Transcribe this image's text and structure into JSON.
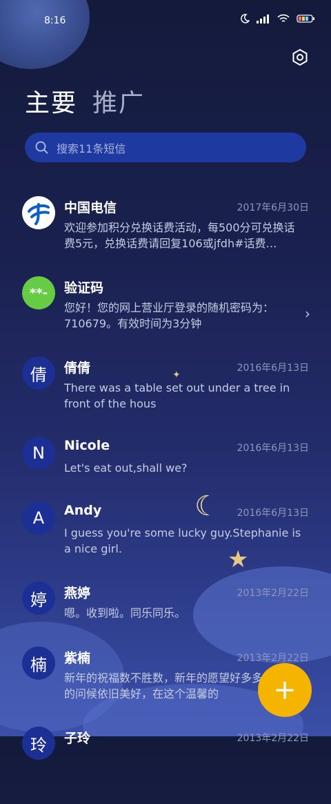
{
  "status": {
    "time": "8:16"
  },
  "tabs": [
    {
      "label": "主要"
    },
    {
      "label": "推广"
    }
  ],
  "search": {
    "placeholder": "搜索11条短信"
  },
  "messages": [
    {
      "name": "中国电信",
      "date": "2017年6月30日",
      "snippet": "欢迎参加积分兑换话费活动，每500分可兑换话费5元，兑换话费请回复106或jfdh#话费…",
      "avatar": ""
    },
    {
      "name": "验证码",
      "date": "",
      "snippet": "您好！您的网上营业厅登录的随机密码为：710679。有效时间为3分钟",
      "avatar": "**-"
    },
    {
      "name": "倩倩",
      "date": "2016年6月13日",
      "snippet": "There was a table set out under a tree in front of the hous",
      "avatar": "倩"
    },
    {
      "name": "Nicole",
      "date": "2016年6月13日",
      "snippet": "Let's eat out,shall we?",
      "avatar": "N"
    },
    {
      "name": "Andy",
      "date": "2016年6月13日",
      "snippet": "I guess you're some lucky guy.Stephanie is a nice girl.",
      "avatar": "A"
    },
    {
      "name": "燕婷",
      "date": "2013年2月22日",
      "snippet": "嗯。收到啦。同乐同乐。",
      "avatar": "婷"
    },
    {
      "name": "紫楠",
      "date": "2013年2月22日",
      "snippet": "新年的祝福数不胜数，新年的愿望好多多，新年的问候依旧美好，在这个温馨的",
      "avatar": "楠"
    },
    {
      "name": "子玲",
      "date": "2013年2月22日",
      "snippet": "",
      "avatar": "玲"
    }
  ],
  "fab": {
    "label": "+"
  },
  "colors": {
    "accent": "#f5b400",
    "search_bg": "#1e3aa0",
    "avatar_bg": "#1c2f94"
  }
}
